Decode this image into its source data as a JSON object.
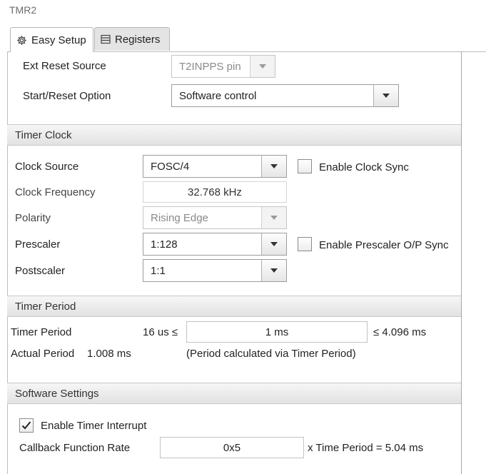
{
  "window": {
    "title": "TMR2"
  },
  "tabs": [
    {
      "label": "Easy Setup",
      "icon": "gear-icon",
      "active": true
    },
    {
      "label": "Registers",
      "icon": "list-icon",
      "active": false
    }
  ],
  "top": {
    "ext_reset_source": {
      "label": "Ext Reset Source",
      "value": "T2INPPS pin"
    },
    "start_reset_option": {
      "label": "Start/Reset Option",
      "value": "Software control"
    }
  },
  "timer_clock": {
    "header": "Timer Clock",
    "clock_source": {
      "label": "Clock Source",
      "value": "FOSC/4"
    },
    "enable_clock_sync": {
      "label": "Enable Clock Sync",
      "checked": false
    },
    "clock_frequency": {
      "label": "Clock Frequency",
      "value": "32.768 kHz"
    },
    "polarity": {
      "label": "Polarity",
      "value": "Rising Edge"
    },
    "prescaler": {
      "label": "Prescaler",
      "value": "1:128"
    },
    "enable_prescaler_sync": {
      "label": "Enable Prescaler O/P Sync",
      "checked": false
    },
    "postscaler": {
      "label": "Postscaler",
      "value": "1:1"
    }
  },
  "timer_period": {
    "header": "Timer Period",
    "label": "Timer Period",
    "min": "16 us ≤",
    "value": "1 ms",
    "max": "≤ 4.096 ms",
    "actual_label": "Actual Period",
    "actual_value": "1.008 ms",
    "note": "(Period calculated via Timer Period)"
  },
  "software_settings": {
    "header": "Software Settings",
    "enable_timer_interrupt": {
      "label": "Enable Timer Interrupt",
      "checked": true
    },
    "callback_rate": {
      "label": "Callback Function Rate",
      "value": "0x5",
      "suffix": "x Time Period = 5.04 ms"
    }
  }
}
